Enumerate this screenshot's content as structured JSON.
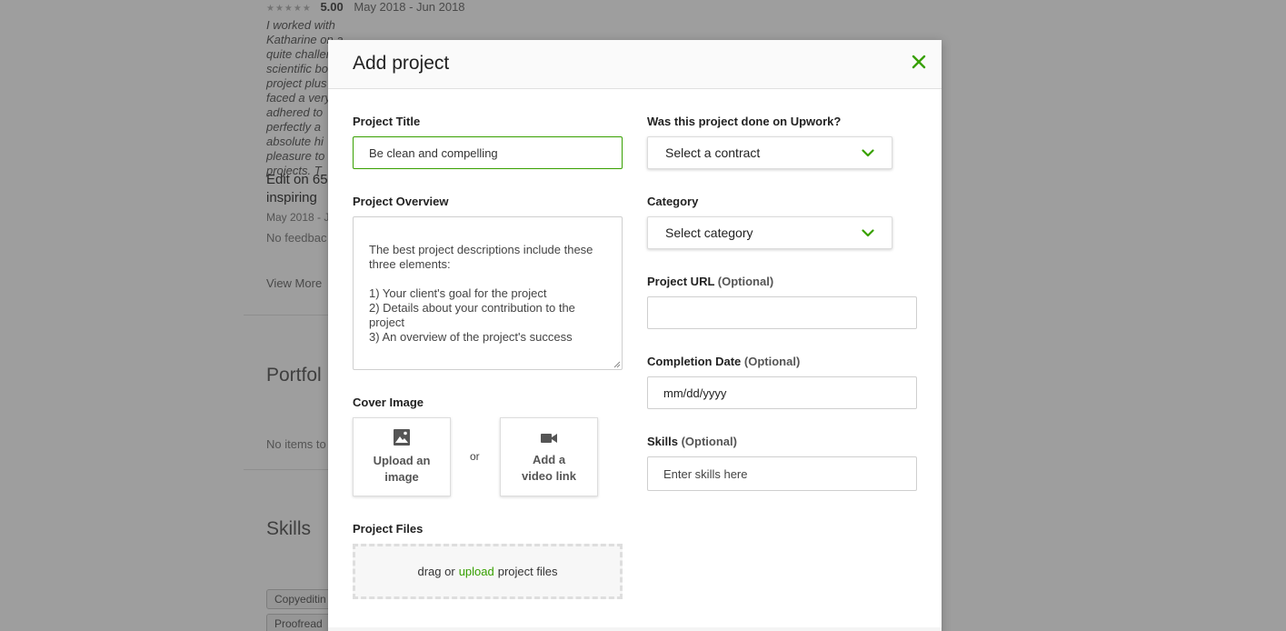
{
  "background": {
    "rating_stars": "★★★★★",
    "rating_score": "5.00",
    "rating_dates": "May 2018 - Jun 2018",
    "review_text": "I worked with Katharine on a quite challenging scientific book project plus we faced a very adhered to perfectly a absolute hi pleasure to projects. T",
    "job_title": "Edit on 65 inspiring",
    "job_date": "May 2018 - J",
    "no_feedback": "No feedbac",
    "view_more": "View More",
    "portfolio_heading": "Portfol",
    "no_items": "No items to",
    "skills_heading": "Skills",
    "skill_chips": [
      "Copyeditin",
      "Proofread"
    ]
  },
  "modal": {
    "title": "Add project",
    "close_icon": "close-icon",
    "project_title": {
      "label": "Project Title",
      "value": "Be clean and compelling"
    },
    "project_overview": {
      "label": "Project Overview",
      "placeholder": "The best project descriptions include these three elements:\n\n1) Your client's goal for the project\n2) Details about your contribution to the project\n3) An overview of the project's success"
    },
    "cover_image": {
      "label": "Cover Image",
      "upload_label": "Upload an image",
      "or_text": "or",
      "video_label": "Add a video link"
    },
    "project_files": {
      "label": "Project Files",
      "text_before": "drag or",
      "link_text": "upload",
      "text_after": "project files"
    },
    "upwork": {
      "label": "Was this project done on Upwork?",
      "selected": "Select a contract"
    },
    "category": {
      "label": "Category",
      "selected": "Select category"
    },
    "project_url": {
      "label": "Project URL",
      "optional": "(Optional)",
      "value": ""
    },
    "completion_date": {
      "label": "Completion Date",
      "optional": "(Optional)",
      "placeholder": "mm/dd/yyyy"
    },
    "skills": {
      "label": "Skills",
      "optional": "(Optional)",
      "placeholder": "Enter skills here"
    }
  },
  "colors": {
    "accent": "#37a000",
    "overlay": "rgba(0,0,0,0.38)"
  }
}
